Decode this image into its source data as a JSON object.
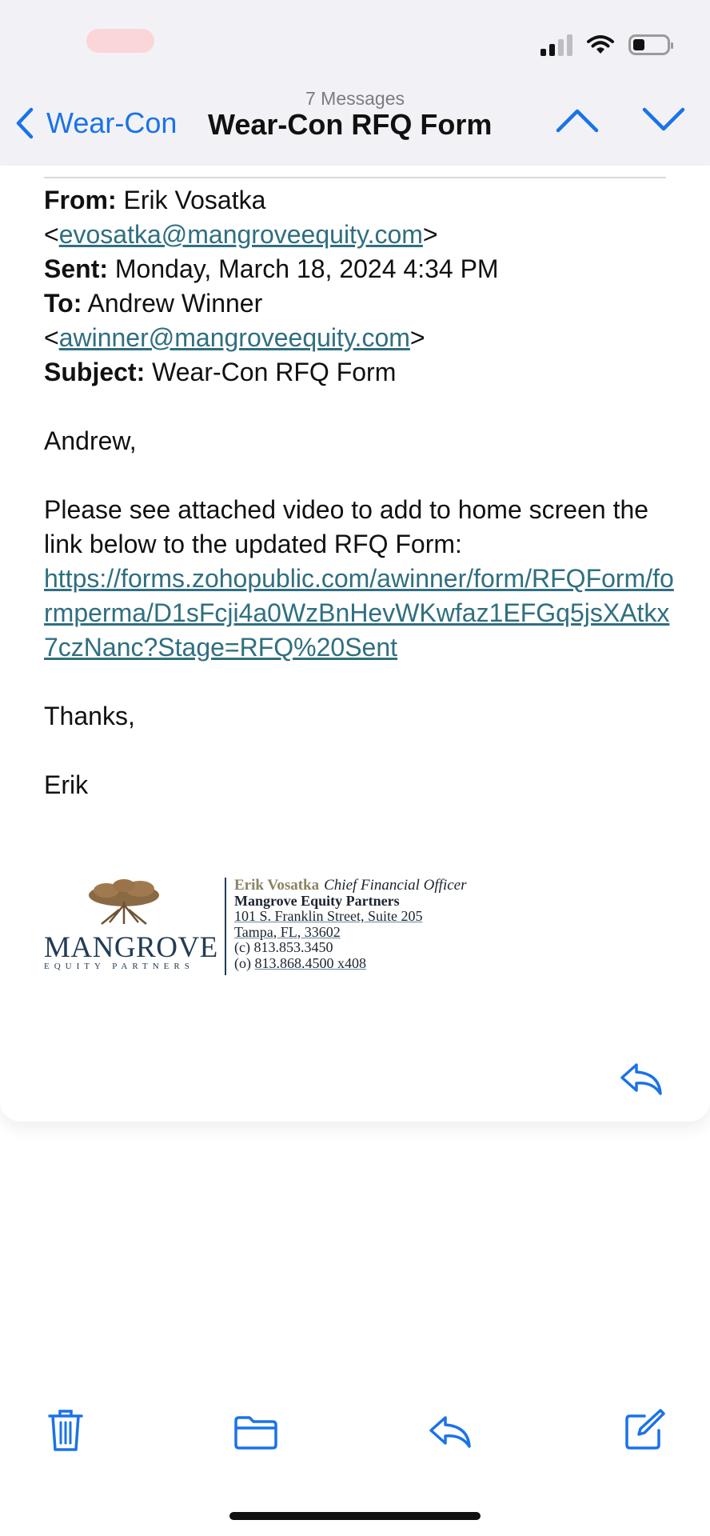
{
  "status_bar": {
    "icons": [
      "signal-icon",
      "wifi-icon",
      "battery-icon"
    ]
  },
  "nav": {
    "message_count": "7 Messages",
    "back_label": "Wear-Con",
    "title": "Wear-Con RFQ Form",
    "icons": [
      "chevron-left-icon",
      "chevron-up-icon",
      "chevron-down-icon"
    ]
  },
  "email": {
    "from_label": "From:",
    "from_name": "Erik Vosatka",
    "from_email": "evosatka@mangroveequity.com",
    "sent_label": "Sent:",
    "sent_value": "Monday, March 18, 2024 4:34 PM",
    "to_label": "To:",
    "to_name": "Andrew Winner",
    "to_email": "awinner@mangroveequity.com",
    "subject_label": "Subject:",
    "subject_value": "Wear-Con RFQ Form",
    "greeting": "Andrew,",
    "body": "Please see attached video to add to home screen the link below to the updated RFQ Form:",
    "link": "https://forms.zohopublic.com/awinner/form/RFQForm/formperma/D1sFcji4a0WzBnHevWKwfaz1EFGq5jsXAtkx7czNanc?Stage=RFQ%20Sent",
    "closing": "Thanks,",
    "signoff": "Erik"
  },
  "signature": {
    "logo_text": "MANGROVE",
    "logo_subtext": "EQUITY PARTNERS",
    "name": "Erik Vosatka",
    "role": "Chief Financial Officer",
    "company": "Mangrove Equity Partners",
    "address1": "101 S. Franklin Street, Suite 205",
    "address2": "Tampa, FL, 33602",
    "cell": "(c) 813.853.3450",
    "office_prefix": "(o) ",
    "office": "813.868.4500 x408"
  },
  "toolbar": {
    "icons": [
      "trash-icon",
      "folder-icon",
      "reply-icon",
      "compose-icon"
    ]
  },
  "colors": {
    "accent": "#1a73e8",
    "link": "#2f6f80",
    "bar_bg": "#f2f2f6"
  }
}
